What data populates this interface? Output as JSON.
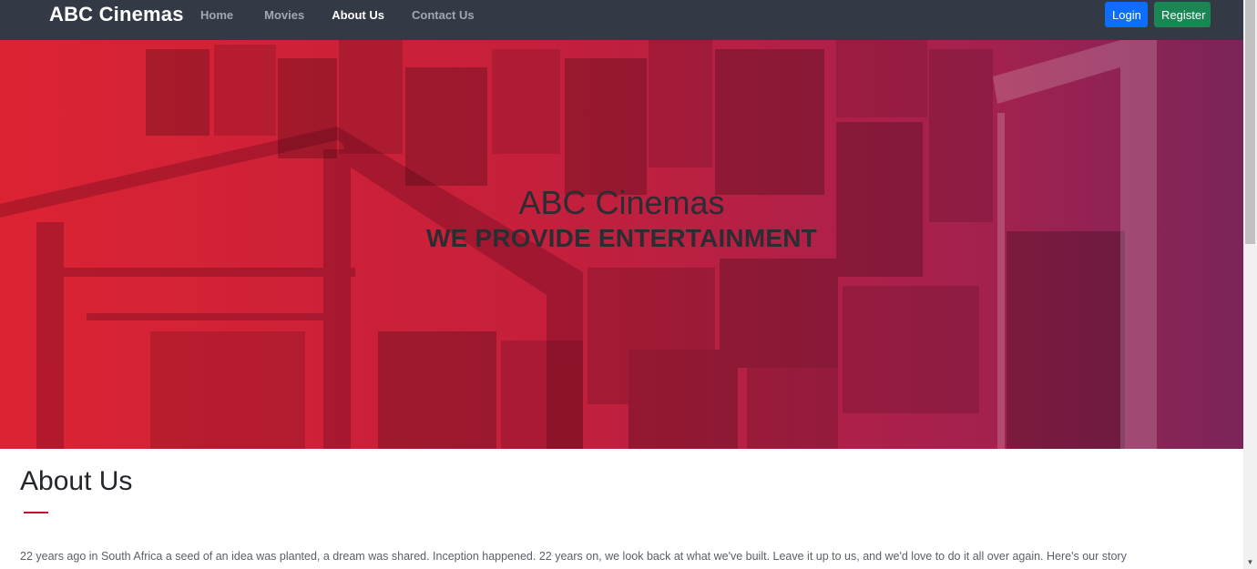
{
  "navbar": {
    "brand": "ABC Cinemas",
    "links": [
      {
        "label": "Home",
        "active": false
      },
      {
        "label": "Movies",
        "active": false
      },
      {
        "label": "About Us",
        "active": true
      },
      {
        "label": "Contact Us",
        "active": false
      }
    ],
    "login_label": "Login",
    "register_label": "Register"
  },
  "hero": {
    "title": "ABC Cinemas",
    "subtitle": "WE PROVIDE ENTERTAINMENT"
  },
  "about": {
    "heading": "About Us",
    "text": "22 years ago in South Africa a seed of an idea was planted, a dream was shared. Inception happened. 22 years on, we look back at what we've built. Leave it up to us, and we'd love to do it all over again. Here's our story"
  },
  "colors": {
    "navbar_bg": "#333a46",
    "login_blue": "#0d6efd",
    "register_green": "#198754",
    "hero_red": "#dc2333",
    "hero_purple": "#7a2559",
    "accent_line": "#c8102e"
  },
  "scrollbar": {
    "up_icon": "chevron-up-icon",
    "down_icon": "chevron-down-icon"
  }
}
